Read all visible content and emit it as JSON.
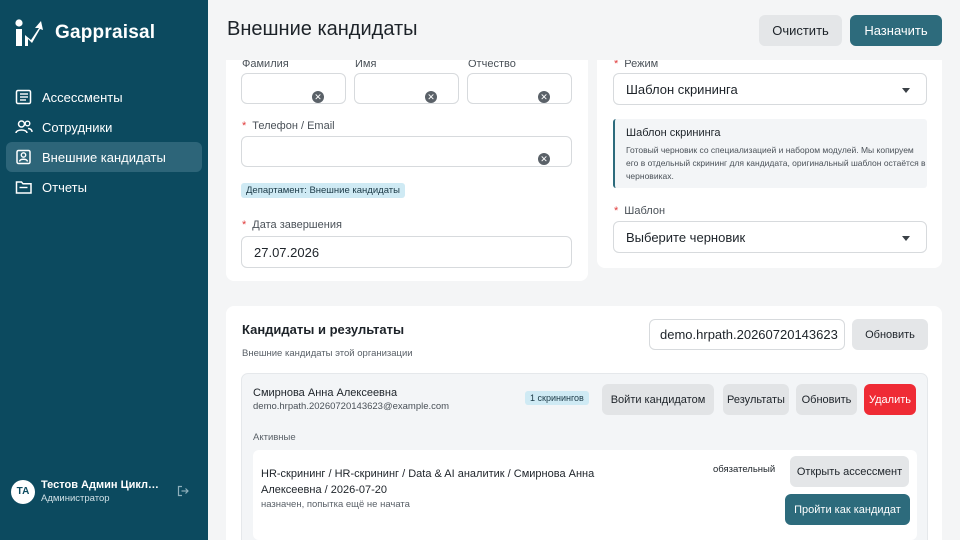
{
  "app": {
    "name": "Gappraisal"
  },
  "sidebar": {
    "items": [
      {
        "label": "Ассессменты"
      },
      {
        "label": "Сотрудники"
      },
      {
        "label": "Внешние кандидаты"
      },
      {
        "label": "Отчеты"
      }
    ],
    "user": {
      "initials": "ТА",
      "name": "Тестов Админ Цикловой",
      "role": "Администратор"
    }
  },
  "header": {
    "title": "Внешние кандидаты",
    "clear_label": "Очистить",
    "assign_label": "Назначить"
  },
  "form": {
    "last_name_label": "Фамилия",
    "first_name_label": "Имя",
    "patronymic_label": "Отчество",
    "last_name_value": "",
    "first_name_value": "",
    "patronymic_value": "",
    "contact_label": "Телефон / Email",
    "contact_value": "",
    "department_chip": "Департамент: Внешние кандидаты",
    "due_label": "Дата завершения",
    "due_value": "27.07.2026"
  },
  "mode": {
    "label": "Режим",
    "value": "Шаблон скрининга",
    "info_title": "Шаблон скрининга",
    "info_text": "Готовый черновик со специализацией и набором модулей. Мы копируем его в отдельный скрининг для кандидата, оригинальный шаблон остаётся в черновиках.",
    "template_label": "Шаблон",
    "template_value": "Выберите черновик"
  },
  "results": {
    "title": "Кандидаты и результаты",
    "subtitle": "Внешние кандидаты этой организации",
    "search_value": "demo.hrpath.20260720143623",
    "refresh_label": "Обновить",
    "candidate": {
      "name": "Смирнова Анна Алексеевна",
      "email": "demo.hrpath.20260720143623@example.com",
      "badge": "1 скринингов",
      "login_label": "Войти кандидатом",
      "results_label": "Результаты",
      "refresh_label": "Обновить",
      "delete_label": "Удалить",
      "active_label": "Активные",
      "assessment": {
        "title_line1": "HR-скрининг / HR-скрининг / Data & AI аналитик / Смирнова Анна",
        "title_line2": "Алексеевна / 2026-07-20",
        "status": "назначен, попытка ещё не начата",
        "required": "обязательный",
        "open_label": "Открыть ассессмент",
        "take_label": "Пройти как кандидат"
      }
    }
  },
  "colors": {
    "sidebar": "#0c4a5f",
    "accent": "#2d6b7c",
    "danger": "#ef2b35",
    "chip": "#cfeaf4"
  }
}
